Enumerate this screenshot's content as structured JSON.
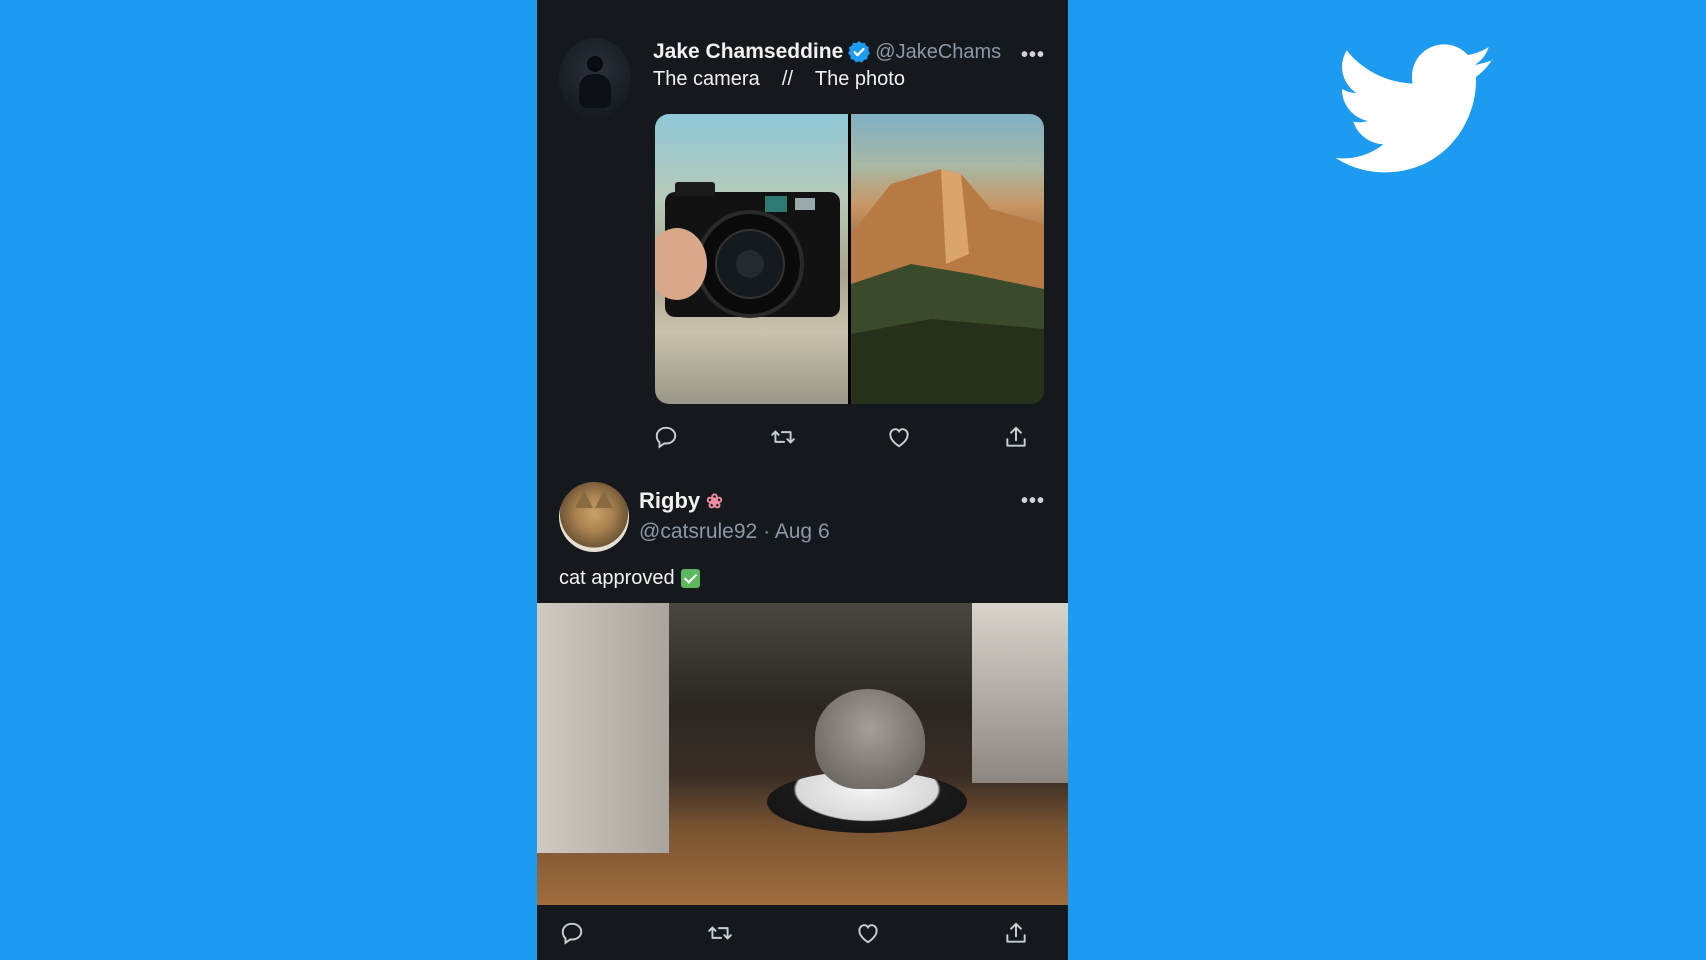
{
  "brand": {
    "logo_icon": "twitter-bird-icon",
    "color": "#ffffff",
    "background": "#1d9bf0"
  },
  "tweet1": {
    "name": "Jake Chamseddine",
    "verified_icon": "verified-badge-icon",
    "handle": "@JakeChams",
    "text": "The camera    //    The photo",
    "media": [
      "camera-photo",
      "mountain-photo"
    ],
    "actions": [
      "reply",
      "retweet",
      "like",
      "share"
    ]
  },
  "tweet2": {
    "name": "Rigby",
    "name_emoji": "❀",
    "handle": "@catsrule92",
    "separator": "·",
    "date": "Aug 6",
    "text": "cat approved",
    "text_emoji_icon": "check-mark-button-icon",
    "media": "cat-on-robot-vacuum-video",
    "actions": [
      "reply",
      "retweet",
      "like",
      "share"
    ]
  },
  "colors": {
    "panel_bg": "#15181d",
    "text_primary": "#f1f1f1",
    "text_secondary": "#8b98a5",
    "verified": "#1d9bf0"
  }
}
